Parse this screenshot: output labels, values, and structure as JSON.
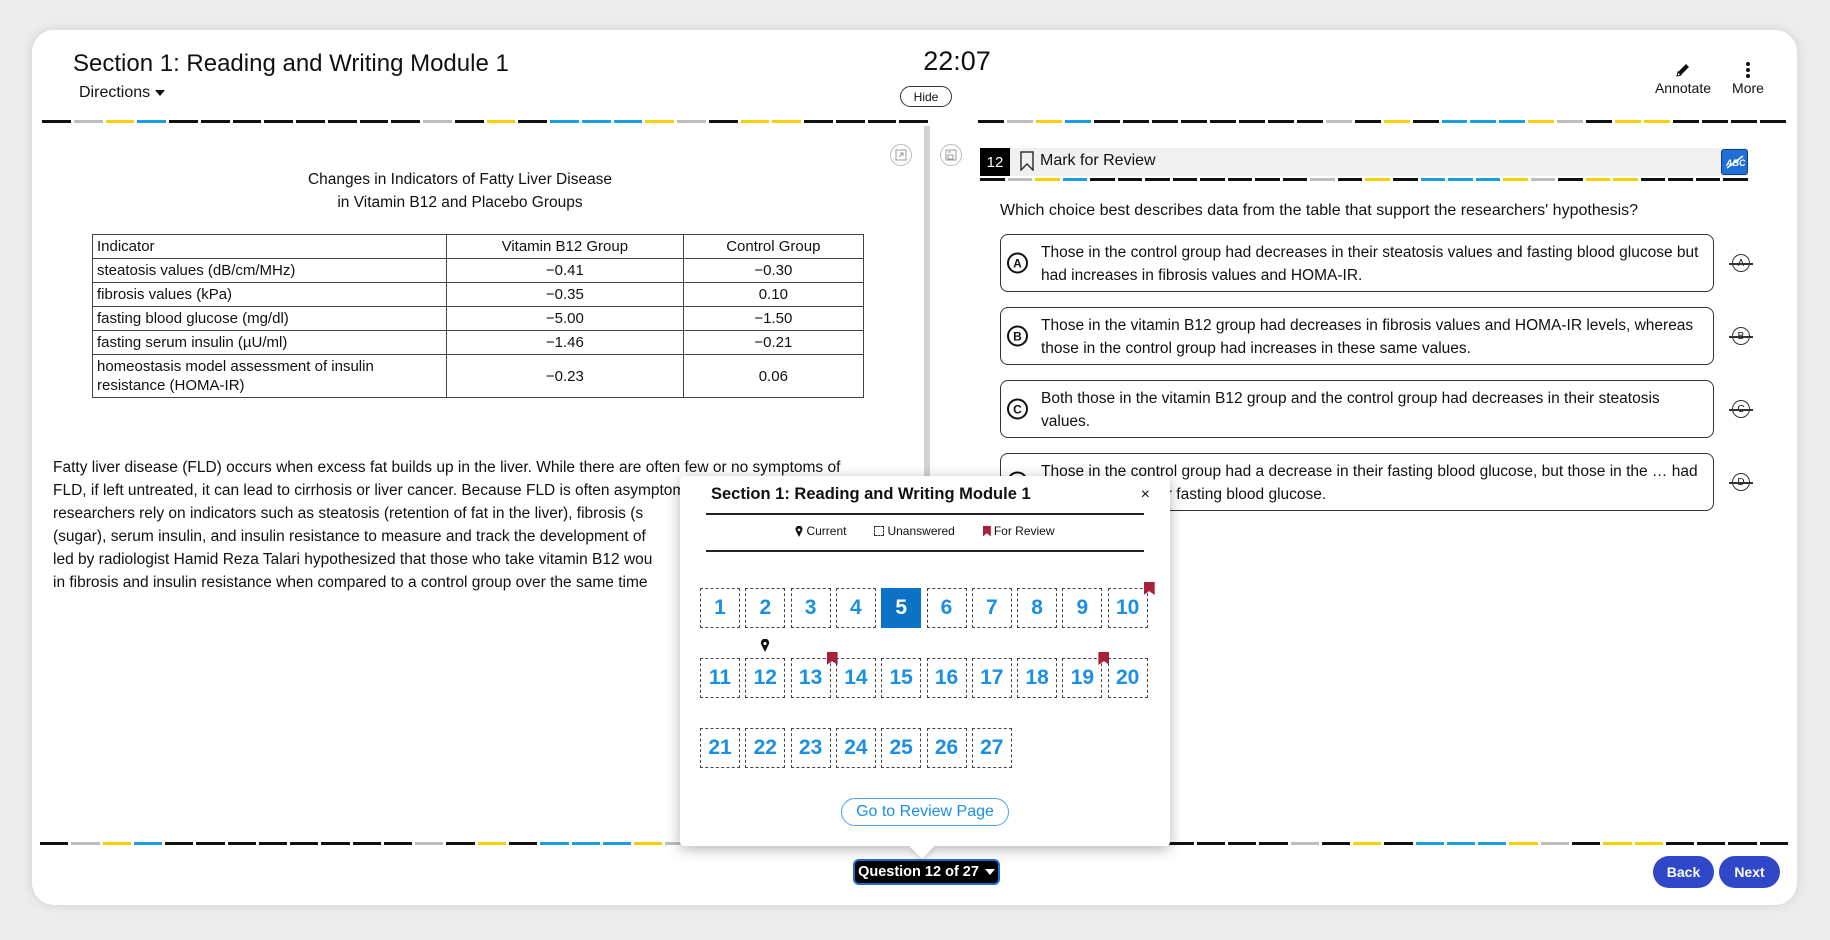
{
  "header": {
    "title": "Section 1: Reading and Writing Module 1",
    "directions_label": "Directions",
    "timer": "22:07",
    "hide_label": "Hide",
    "annotate_label": "Annotate",
    "more_label": "More"
  },
  "progress_pattern": [
    "k",
    "g",
    "y",
    "b",
    "k",
    "k",
    "k",
    "k",
    "k",
    "k",
    "k",
    "k",
    "g",
    "k",
    "y",
    "k",
    "b",
    "b",
    "b",
    "y",
    "g",
    "k",
    "y",
    "y",
    "k",
    "k",
    "k",
    "k"
  ],
  "figure": {
    "title_line1": "Changes in Indicators of Fatty Liver Disease",
    "title_line2": "in Vitamin B12 and Placebo Groups",
    "columns": [
      "Indicator",
      "Vitamin B12 Group",
      "Control Group"
    ],
    "rows": [
      [
        "steatosis values (dB/cm/MHz)",
        "−0.41",
        "−0.30"
      ],
      [
        "fibrosis values (kPa)",
        "−0.35",
        "0.10"
      ],
      [
        "fasting blood glucose (mg/dl)",
        "−5.00",
        "−1.50"
      ],
      [
        "fasting serum insulin (µU/ml)",
        "−1.46",
        "−0.21"
      ],
      [
        "homeostasis model assessment of insulin resistance (HOMA-IR)",
        "−0.23",
        "0.06"
      ]
    ]
  },
  "passage": "Fatty liver disease (FLD) occurs when excess fat builds up in the liver. While there are often few or no symptoms of FLD, if left untreated, it can lead to cirrhosis or liver cancer. Because FLD is often asymptomatic, doctors and researchers rely on indicators such as steatosis (retention of fat in the liver), fibrosis (s… (sugar), serum insulin, and insulin resistance to measure and track the development of… led by radiologist Hamid Reza Talari hypothesized that those who take vitamin B12 wou… in fibrosis and insulin resistance when compared to a control group over the same time…",
  "passage_lines": [
    "Fatty liver disease (FLD) occurs when excess fat builds up in the liver. While there are often few or no symptoms of",
    "FLD, if left untreated, it can lead to cirrhosis or liver cancer. Because FLD is often asymptomatic, doctors and",
    "researchers rely on indicators such as steatosis (retention of fat in the liver), fibrosis (s",
    "(sugar), serum insulin, and insulin resistance to measure and track the development of",
    "led by radiologist Hamid Reza Talari hypothesized that those who take vitamin B12 wou",
    "in fibrosis and insulin resistance when compared to a control group over the same time"
  ],
  "question": {
    "number": "12",
    "mark_label": "Mark for Review",
    "abc_label": "ABC",
    "prompt": "Which choice best describes data from the table that support the researchers' hypothesis?",
    "choices": [
      {
        "letter": "A",
        "text": "Those in the control group had decreases in their steatosis values and fasting blood glucose but had increases in fibrosis values and HOMA-IR."
      },
      {
        "letter": "B",
        "text": "Those in the vitamin B12 group had decreases in fibrosis values and HOMA-IR levels, whereas those in the control group had increases in these same values."
      },
      {
        "letter": "C",
        "text": "Both those in the vitamin B12 group and the control group had decreases in their steatosis values."
      },
      {
        "letter": "D",
        "text": "Those in the control group had a decrease in their fasting blood glucose, but those in the … had an increase in their fasting blood glucose."
      }
    ]
  },
  "footer": {
    "question_nav_label": "Question 12 of 27",
    "back_label": "Back",
    "next_label": "Next"
  },
  "popup": {
    "title": "Section 1: Reading and Writing Module 1",
    "close_label": "×",
    "legend": {
      "current": "Current",
      "unanswered": "Unanswered",
      "review": "For Review"
    },
    "questions": [
      {
        "n": "1"
      },
      {
        "n": "2"
      },
      {
        "n": "3"
      },
      {
        "n": "4"
      },
      {
        "n": "5",
        "answered": true
      },
      {
        "n": "6"
      },
      {
        "n": "7"
      },
      {
        "n": "8"
      },
      {
        "n": "9"
      },
      {
        "n": "10",
        "review": true
      },
      {
        "n": "11"
      },
      {
        "n": "12",
        "current": true
      },
      {
        "n": "13",
        "review": true
      },
      {
        "n": "14"
      },
      {
        "n": "15"
      },
      {
        "n": "16"
      },
      {
        "n": "17"
      },
      {
        "n": "18"
      },
      {
        "n": "19",
        "review": true
      },
      {
        "n": "20"
      },
      {
        "n": "21"
      },
      {
        "n": "22"
      },
      {
        "n": "23"
      },
      {
        "n": "24"
      },
      {
        "n": "25"
      },
      {
        "n": "26"
      },
      {
        "n": "27"
      }
    ],
    "review_button_label": "Go to Review Page"
  },
  "colors": {
    "accent_blue": "#1a8fe3",
    "answered_blue": "#0b72c8",
    "nav_button": "#3048c8",
    "review_flag": "#a8203a"
  }
}
